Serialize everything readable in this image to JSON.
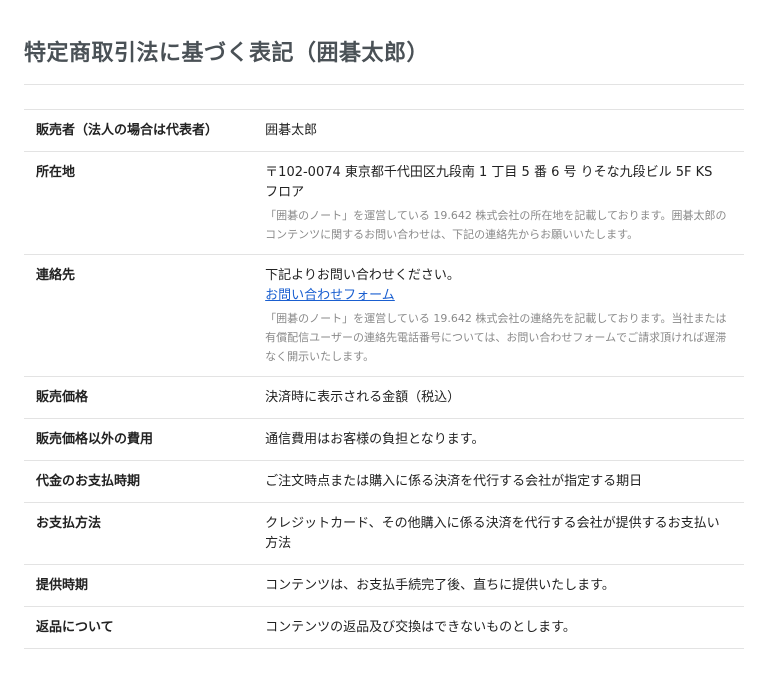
{
  "page": {
    "title": "特定商取引法に基づく表記（囲碁太郎）"
  },
  "table": {
    "seller": {
      "label": "販売者（法人の場合は代表者）",
      "value": "囲碁太郎"
    },
    "address": {
      "label": "所在地",
      "value": "〒102-0074 東京都千代田区九段南 1 丁目 5 番 6 号 りそな九段ビル 5F KS フロア",
      "note": "「囲碁のノート」を運営している 19.642 株式会社の所在地を記載しております。囲碁太郎のコンテンツに関するお問い合わせは、下記の連絡先からお願いいたします。"
    },
    "contact": {
      "label": "連絡先",
      "value": "下記よりお問い合わせください。",
      "link_label": "お問い合わせフォーム",
      "note": "「囲碁のノート」を運営している 19.642 株式会社の連絡先を記載しております。当社または有償配信ユーザーの連絡先電話番号については、お問い合わせフォームでご請求頂ければ遅滞なく開示いたします。"
    },
    "price": {
      "label": "販売価格",
      "value": "決済時に表示される金額（税込）"
    },
    "other_fees": {
      "label": "販売価格以外の費用",
      "value": "通信費用はお客様の負担となります。"
    },
    "payment_timing": {
      "label": "代金のお支払時期",
      "value": "ご注文時点または購入に係る決済を代行する会社が指定する期日"
    },
    "payment_method": {
      "label": "お支払方法",
      "value": "クレジットカード、その他購入に係る決済を代行する会社が提供するお支払い方法"
    },
    "delivery_timing": {
      "label": "提供時期",
      "value": "コンテンツは、お支払手続完了後、直ちに提供いたします。"
    },
    "returns": {
      "label": "返品について",
      "value": "コンテンツの返品及び交換はできないものとします。"
    }
  }
}
